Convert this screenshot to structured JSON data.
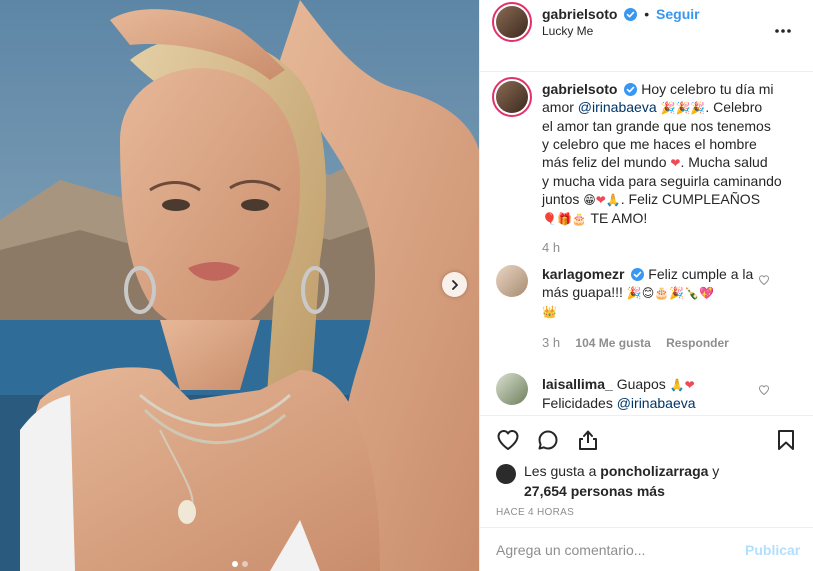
{
  "post": {
    "author": "gabrielsoto",
    "follow_label": "Seguir",
    "separator": "•",
    "location": "Lucky Me",
    "more_icon": "more-horizontal-icon"
  },
  "caption": {
    "author": "gabrielsoto",
    "line1": "Hoy celebro tu día mi",
    "line2_prefix": "amor ",
    "mention": "@irinabaeva",
    "line2_suffix": ". Celebro",
    "line3": "el amor tan grande que nos tenemos",
    "line4": "y celebro que me haces el hombre",
    "line5": "más feliz del mundo",
    "line5_suffix": ". Mucha salud",
    "line6": "y mucha vida para seguirla caminando",
    "line7_prefix": "juntos",
    "line7_suffix": ". Feliz CUMPLEAÑOS",
    "line8_suffix": "TE AMO!",
    "time": "4 h"
  },
  "comments": [
    {
      "username": "karlagomezr",
      "text1": "Feliz cumple a la",
      "text2": "más guapa!!!",
      "time": "3 h",
      "likes": "104 Me gusta",
      "reply": "Responder"
    },
    {
      "username": "laisallima_",
      "text1": "Guapos",
      "text2_prefix": "Felicidades ",
      "mention": "@irinabaeva"
    }
  ],
  "likes": {
    "prefix": "Les gusta a ",
    "user": "poncholizarraga",
    "suffix": " y",
    "count": "27,654 personas más"
  },
  "time_ago": "HACE 4 HORAS",
  "comment_box": {
    "placeholder": "Agrega un comentario...",
    "publish": "Publicar"
  },
  "colors": {
    "link": "#3897f0",
    "mention": "#003569",
    "muted": "#8e8e8e",
    "heart": "#ed4956",
    "publish_disabled": "#b2dffc"
  }
}
